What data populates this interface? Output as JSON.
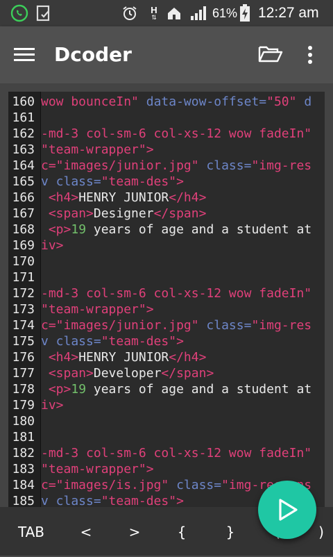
{
  "status": {
    "battery": "61%",
    "time": "12:27 am",
    "network": "H",
    "icons": [
      "whatsapp-icon",
      "task-icon",
      "alarm-icon",
      "network-h-icon",
      "home-icon",
      "signal-icon",
      "battery-charging-icon"
    ]
  },
  "appbar": {
    "title": "Dcoder",
    "menu_icon": "hamburger-icon",
    "folder_icon": "folder-open-icon",
    "more_icon": "more-vert-icon"
  },
  "editor": {
    "lines": [
      {
        "n": "160",
        "seg": [
          {
            "c": "s",
            "t": "wow bounceIn\""
          },
          {
            "c": "a",
            "t": " data-wow-offset="
          },
          {
            "c": "s",
            "t": "\"50\""
          },
          {
            "c": "a",
            "t": " d"
          }
        ]
      },
      {
        "n": "161",
        "seg": []
      },
      {
        "n": "162",
        "seg": [
          {
            "c": "s",
            "t": "-md-3 col-sm-6 col-xs-12 wow fadeIn\""
          }
        ]
      },
      {
        "n": "163",
        "seg": [
          {
            "c": "s",
            "t": "\"team-wrapper\""
          },
          {
            "c": "t",
            "t": ">"
          }
        ]
      },
      {
        "n": "164",
        "seg": [
          {
            "c": "s",
            "t": "c=\"images/junior.jpg\""
          },
          {
            "c": "a",
            "t": " class="
          },
          {
            "c": "s",
            "t": "\"img-res"
          }
        ]
      },
      {
        "n": "165",
        "seg": [
          {
            "c": "a",
            "t": "v class="
          },
          {
            "c": "s",
            "t": "\"team-des\""
          },
          {
            "c": "t",
            "t": ">"
          }
        ]
      },
      {
        "n": "166",
        "seg": [
          {
            "c": "w",
            "t": " "
          },
          {
            "c": "t",
            "t": "<h4>"
          },
          {
            "c": "w",
            "t": "HENRY JUNIOR"
          },
          {
            "c": "t",
            "t": "</h4>"
          }
        ]
      },
      {
        "n": "167",
        "seg": [
          {
            "c": "w",
            "t": " "
          },
          {
            "c": "t",
            "t": "<span>"
          },
          {
            "c": "w",
            "t": "Designer"
          },
          {
            "c": "t",
            "t": "</span>"
          }
        ]
      },
      {
        "n": "168",
        "seg": [
          {
            "c": "w",
            "t": " "
          },
          {
            "c": "t",
            "t": "<p>"
          },
          {
            "c": "g",
            "t": "19"
          },
          {
            "c": "w",
            "t": " years of age and a student at"
          }
        ]
      },
      {
        "n": "169",
        "seg": [
          {
            "c": "t",
            "t": "iv>"
          }
        ]
      },
      {
        "n": "170",
        "seg": []
      },
      {
        "n": "171",
        "seg": []
      },
      {
        "n": "172",
        "seg": [
          {
            "c": "s",
            "t": "-md-3 col-sm-6 col-xs-12 wow fadeIn\""
          }
        ]
      },
      {
        "n": "173",
        "seg": [
          {
            "c": "s",
            "t": "\"team-wrapper\""
          },
          {
            "c": "t",
            "t": ">"
          }
        ]
      },
      {
        "n": "174",
        "seg": [
          {
            "c": "s",
            "t": "c=\"images/junior.jpg\""
          },
          {
            "c": "a",
            "t": " class="
          },
          {
            "c": "s",
            "t": "\"img-res"
          }
        ]
      },
      {
        "n": "175",
        "seg": [
          {
            "c": "a",
            "t": "v class="
          },
          {
            "c": "s",
            "t": "\"team-des\""
          },
          {
            "c": "t",
            "t": ">"
          }
        ]
      },
      {
        "n": "176",
        "seg": [
          {
            "c": "w",
            "t": " "
          },
          {
            "c": "t",
            "t": "<h4>"
          },
          {
            "c": "w",
            "t": "HENRY JUNIOR"
          },
          {
            "c": "t",
            "t": "</h4>"
          }
        ]
      },
      {
        "n": "177",
        "seg": [
          {
            "c": "w",
            "t": " "
          },
          {
            "c": "t",
            "t": "<span>"
          },
          {
            "c": "w",
            "t": "Developer"
          },
          {
            "c": "t",
            "t": "</span>"
          }
        ]
      },
      {
        "n": "178",
        "seg": [
          {
            "c": "w",
            "t": " "
          },
          {
            "c": "t",
            "t": "<p>"
          },
          {
            "c": "g",
            "t": "19"
          },
          {
            "c": "w",
            "t": " years of age and a student at"
          }
        ]
      },
      {
        "n": "179",
        "seg": [
          {
            "c": "t",
            "t": "iv>"
          }
        ]
      },
      {
        "n": "180",
        "seg": []
      },
      {
        "n": "181",
        "seg": []
      },
      {
        "n": "182",
        "seg": [
          {
            "c": "s",
            "t": "-md-3 col-sm-6 col-xs-12 wow fadeIn\""
          }
        ]
      },
      {
        "n": "183",
        "seg": [
          {
            "c": "s",
            "t": "\"team-wrapper\""
          },
          {
            "c": "t",
            "t": ">"
          }
        ]
      },
      {
        "n": "184",
        "seg": [
          {
            "c": "s",
            "t": "c=\"images/is.jpg\""
          },
          {
            "c": "a",
            "t": " class="
          },
          {
            "c": "s",
            "t": "\"img-respons"
          }
        ]
      },
      {
        "n": "185",
        "seg": [
          {
            "c": "a",
            "t": "v class="
          },
          {
            "c": "s",
            "t": "\"team-des\""
          },
          {
            "c": "t",
            "t": ">"
          }
        ]
      }
    ]
  },
  "keys": [
    "TAB",
    "<",
    ">",
    "{",
    "}",
    "(",
    ")"
  ],
  "fab": {
    "icon": "run-play-icon"
  },
  "colors": {
    "accent": "#1fc7a4",
    "string": "#e0407a",
    "attr": "#6d86c9",
    "number": "#73c06b"
  }
}
